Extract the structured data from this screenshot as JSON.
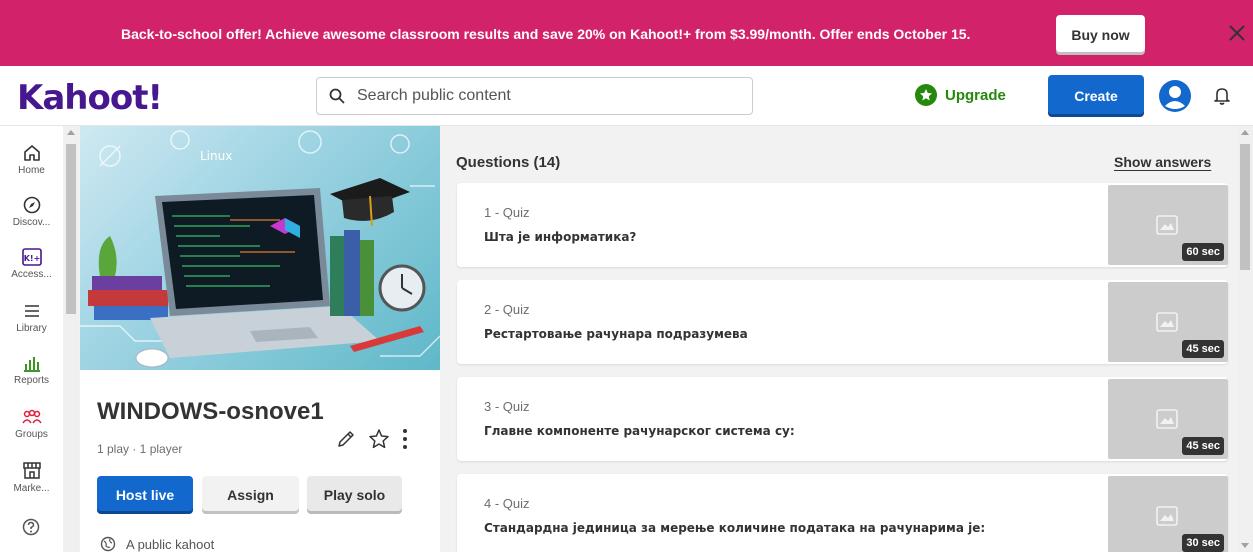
{
  "banner": {
    "text": "Back-to-school offer! Achieve awesome classroom results and save 20% on Kahoot!+ from $3.99/month. Offer ends October 15.",
    "buy_label": "Buy now",
    "background": "#d2236a"
  },
  "header": {
    "logo": "Kahoot!",
    "search_placeholder": "Search public content",
    "upgrade_label": "Upgrade",
    "create_label": "Create"
  },
  "sidebar": {
    "items": [
      {
        "label": "Home",
        "icon": "home-icon"
      },
      {
        "label": "Discov...",
        "icon": "compass-icon"
      },
      {
        "label": "Access...",
        "icon": "kahoot-plus-icon"
      },
      {
        "label": "Library",
        "icon": "list-icon"
      },
      {
        "label": "Reports",
        "icon": "bar-chart-icon"
      },
      {
        "label": "Groups",
        "icon": "groups-icon"
      },
      {
        "label": "Marke...",
        "icon": "store-icon"
      }
    ],
    "help_icon": "help-icon"
  },
  "kahoot": {
    "title": "WINDOWS-osnove1",
    "meta": "1 play · 1 player",
    "host_label": "Host live",
    "assign_label": "Assign",
    "solo_label": "Play solo",
    "visibility": "A public kahoot",
    "cover_text": "Linux"
  },
  "questions": {
    "heading": "Questions (14)",
    "show_answers": "Show answers",
    "items": [
      {
        "type": "1 - Quiz",
        "text": "Шта је информатика?",
        "time": "60 sec"
      },
      {
        "type": "2 - Quiz",
        "text": "Рестартовање рачунара подразумева",
        "time": "45 sec"
      },
      {
        "type": "3 - Quiz",
        "text": "Главне компоненте рачунарског система су:",
        "time": "45 sec"
      },
      {
        "type": "4 - Quiz",
        "text": "Стандардна јединица за мерење количине података на рачунарима је:",
        "time": "30 sec"
      }
    ]
  },
  "colors": {
    "brand_purple": "#46178f",
    "primary_blue": "#1368ce",
    "upgrade_green": "#26890c"
  }
}
